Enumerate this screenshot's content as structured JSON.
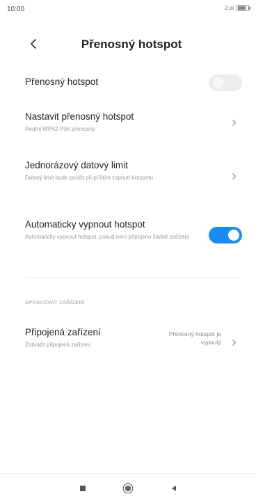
{
  "status": {
    "time": "10:00",
    "signal": "2.al",
    "battery": "(98)"
  },
  "header": {
    "title": "Přenosný hotspot"
  },
  "rows": [
    {
      "title": "Přenosný hotspot",
      "toggle": false
    },
    {
      "title": "Nastavit přenosný hotspot",
      "subtitle": "Redmi WPA2 PSK přenosný"
    },
    {
      "title": "Jednorázový datový limit",
      "subtitle": "Datový limit bude použit při příštím zapnutí hotspotu"
    },
    {
      "title": "Automaticky vypnout hotspot",
      "subtitle": "Automaticky vypnout hotspot, pokud není připojeno žádné zařízení",
      "toggle": true
    }
  ],
  "section": {
    "label": "SPRAVOVAT ZAŘÍZENÍ"
  },
  "devices": {
    "title": "Připojená zařízení",
    "subtitle": "Zobrazit připojená zařízení",
    "value": "Přenosný hotspot je vypnutý"
  },
  "colors": {
    "accent": "#1a8cf0",
    "toggle_off": "#ececec"
  }
}
